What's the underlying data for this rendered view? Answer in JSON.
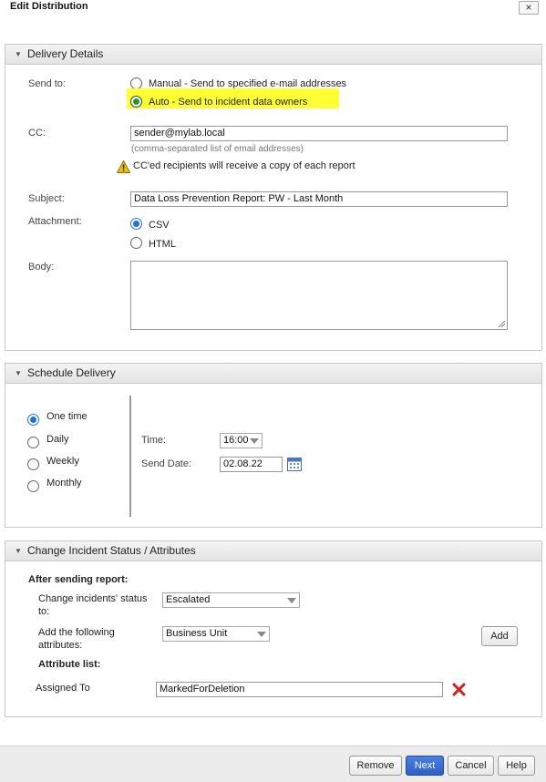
{
  "dialog": {
    "title": "Edit Distribution",
    "close_label": "×"
  },
  "delivery": {
    "header": "Delivery Details",
    "send_to_label": "Send to:",
    "option_manual": "Manual - Send to specified e-mail addresses",
    "option_auto": "Auto - Send to incident data owners",
    "selected": "auto",
    "cc_label": "CC:",
    "cc_value": "sender@mylab.local",
    "cc_hint": "(comma-separated list of email addresses)",
    "cc_warning": "CC'ed recipients will receive a copy of each report",
    "subject_label": "Subject:",
    "subject_value": "Data Loss Prevention Report: PW - Last Month",
    "attachment_label": "Attachment:",
    "attachment_csv": "CSV",
    "attachment_html": "HTML",
    "attachment_selected": "CSV",
    "body_label": "Body:",
    "body_value": ""
  },
  "schedule": {
    "header": "Schedule Delivery",
    "options": [
      "One time",
      "Daily",
      "Weekly",
      "Monthly"
    ],
    "selected": "One time",
    "time_label": "Time:",
    "time_value": "16:00",
    "send_date_label": "Send Date:",
    "send_date_value": "02.08.22"
  },
  "status": {
    "header": "Change Incident Status / Attributes",
    "after_sending": "After sending report:",
    "change_status_label_1": "Change incidents' status",
    "change_status_label_2": "to:",
    "change_status_value": "Escalated",
    "add_attr_label_1": "Add the following",
    "add_attr_label_2": "attributes:",
    "add_attr_value": "Business Unit",
    "add_button": "Add",
    "attribute_list_label": "Attribute list:",
    "attribute_name": "Assigned To",
    "attribute_value": "MarkedForDeletion"
  },
  "footer": {
    "remove": "Remove",
    "next": "Next",
    "cancel": "Cancel",
    "help": "Help"
  },
  "colors": {
    "highlight": "#ffff33",
    "radio_accent": "#1e73d8",
    "primary_button": "#2e5fc8",
    "delete_icon": "#d62020",
    "warning_icon": "#f2c200"
  }
}
